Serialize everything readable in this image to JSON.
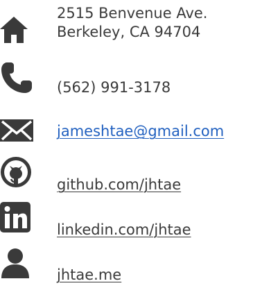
{
  "contact": {
    "address": {
      "icon": "home-icon",
      "line1": "2515 Benvenue Ave.",
      "line2": "Berkeley, CA 94704"
    },
    "phone": {
      "icon": "phone-icon",
      "text": "(562) 991-3178"
    },
    "email": {
      "icon": "envelope-icon",
      "text": "jameshtae@gmail.com",
      "color": "#1f5fbf"
    },
    "github": {
      "icon": "github-icon",
      "text": "github.com/jhtae"
    },
    "linkedin": {
      "icon": "linkedin-icon",
      "text": "linkedin.com/jhtae"
    },
    "website": {
      "icon": "person-icon",
      "text": "jhtae.me"
    }
  },
  "colors": {
    "icon": "#3a3a3a",
    "text": "#3a3a3a",
    "link_accent": "#1f5fbf"
  }
}
